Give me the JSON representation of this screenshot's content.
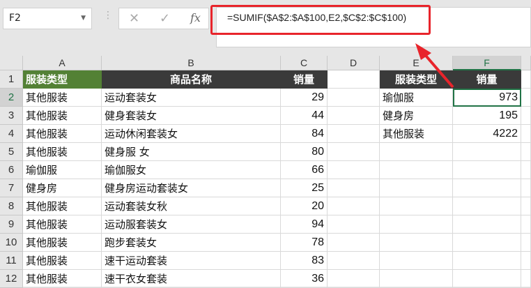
{
  "name_box": "F2",
  "formula_bar": {
    "cancel": "✕",
    "enter": "✓",
    "fx": "fx",
    "formula": "=SUMIF($A$2:$A$100,E2,$C$2:$C$100)"
  },
  "columns": [
    "A",
    "B",
    "C",
    "D",
    "E",
    "F"
  ],
  "rows": [
    "1",
    "2",
    "3",
    "4",
    "5",
    "6",
    "7",
    "8",
    "9",
    "10",
    "11",
    "12"
  ],
  "table": {
    "headers": [
      "服装类型",
      "商品名称",
      "销量"
    ],
    "data": [
      [
        "其他服装",
        "运动套装女",
        "29"
      ],
      [
        "其他服装",
        "健身套装女",
        "44"
      ],
      [
        "其他服装",
        "运动休闲套装女",
        "84"
      ],
      [
        "其他服装",
        "健身服 女",
        "80"
      ],
      [
        "瑜伽服",
        "瑜伽服女",
        "66"
      ],
      [
        "健身房",
        "健身房运动套装女",
        "25"
      ],
      [
        "其他服装",
        "运动套装女秋",
        "20"
      ],
      [
        "其他服装",
        "运动服套装女",
        "94"
      ],
      [
        "其他服装",
        "跑步套装女",
        "78"
      ],
      [
        "其他服装",
        "速干运动套装",
        "83"
      ],
      [
        "其他服装",
        "速干衣女套装",
        "36"
      ]
    ]
  },
  "summary": {
    "headers": [
      "服装类型",
      "销量"
    ],
    "data": [
      [
        "瑜伽服",
        "973"
      ],
      [
        "健身房",
        "195"
      ],
      [
        "其他服装",
        "4222"
      ]
    ]
  },
  "colors": {
    "accent": "#217346",
    "highlight": "#e8242b",
    "header_dark": "#3a3a3a",
    "header_green": "#538135"
  }
}
